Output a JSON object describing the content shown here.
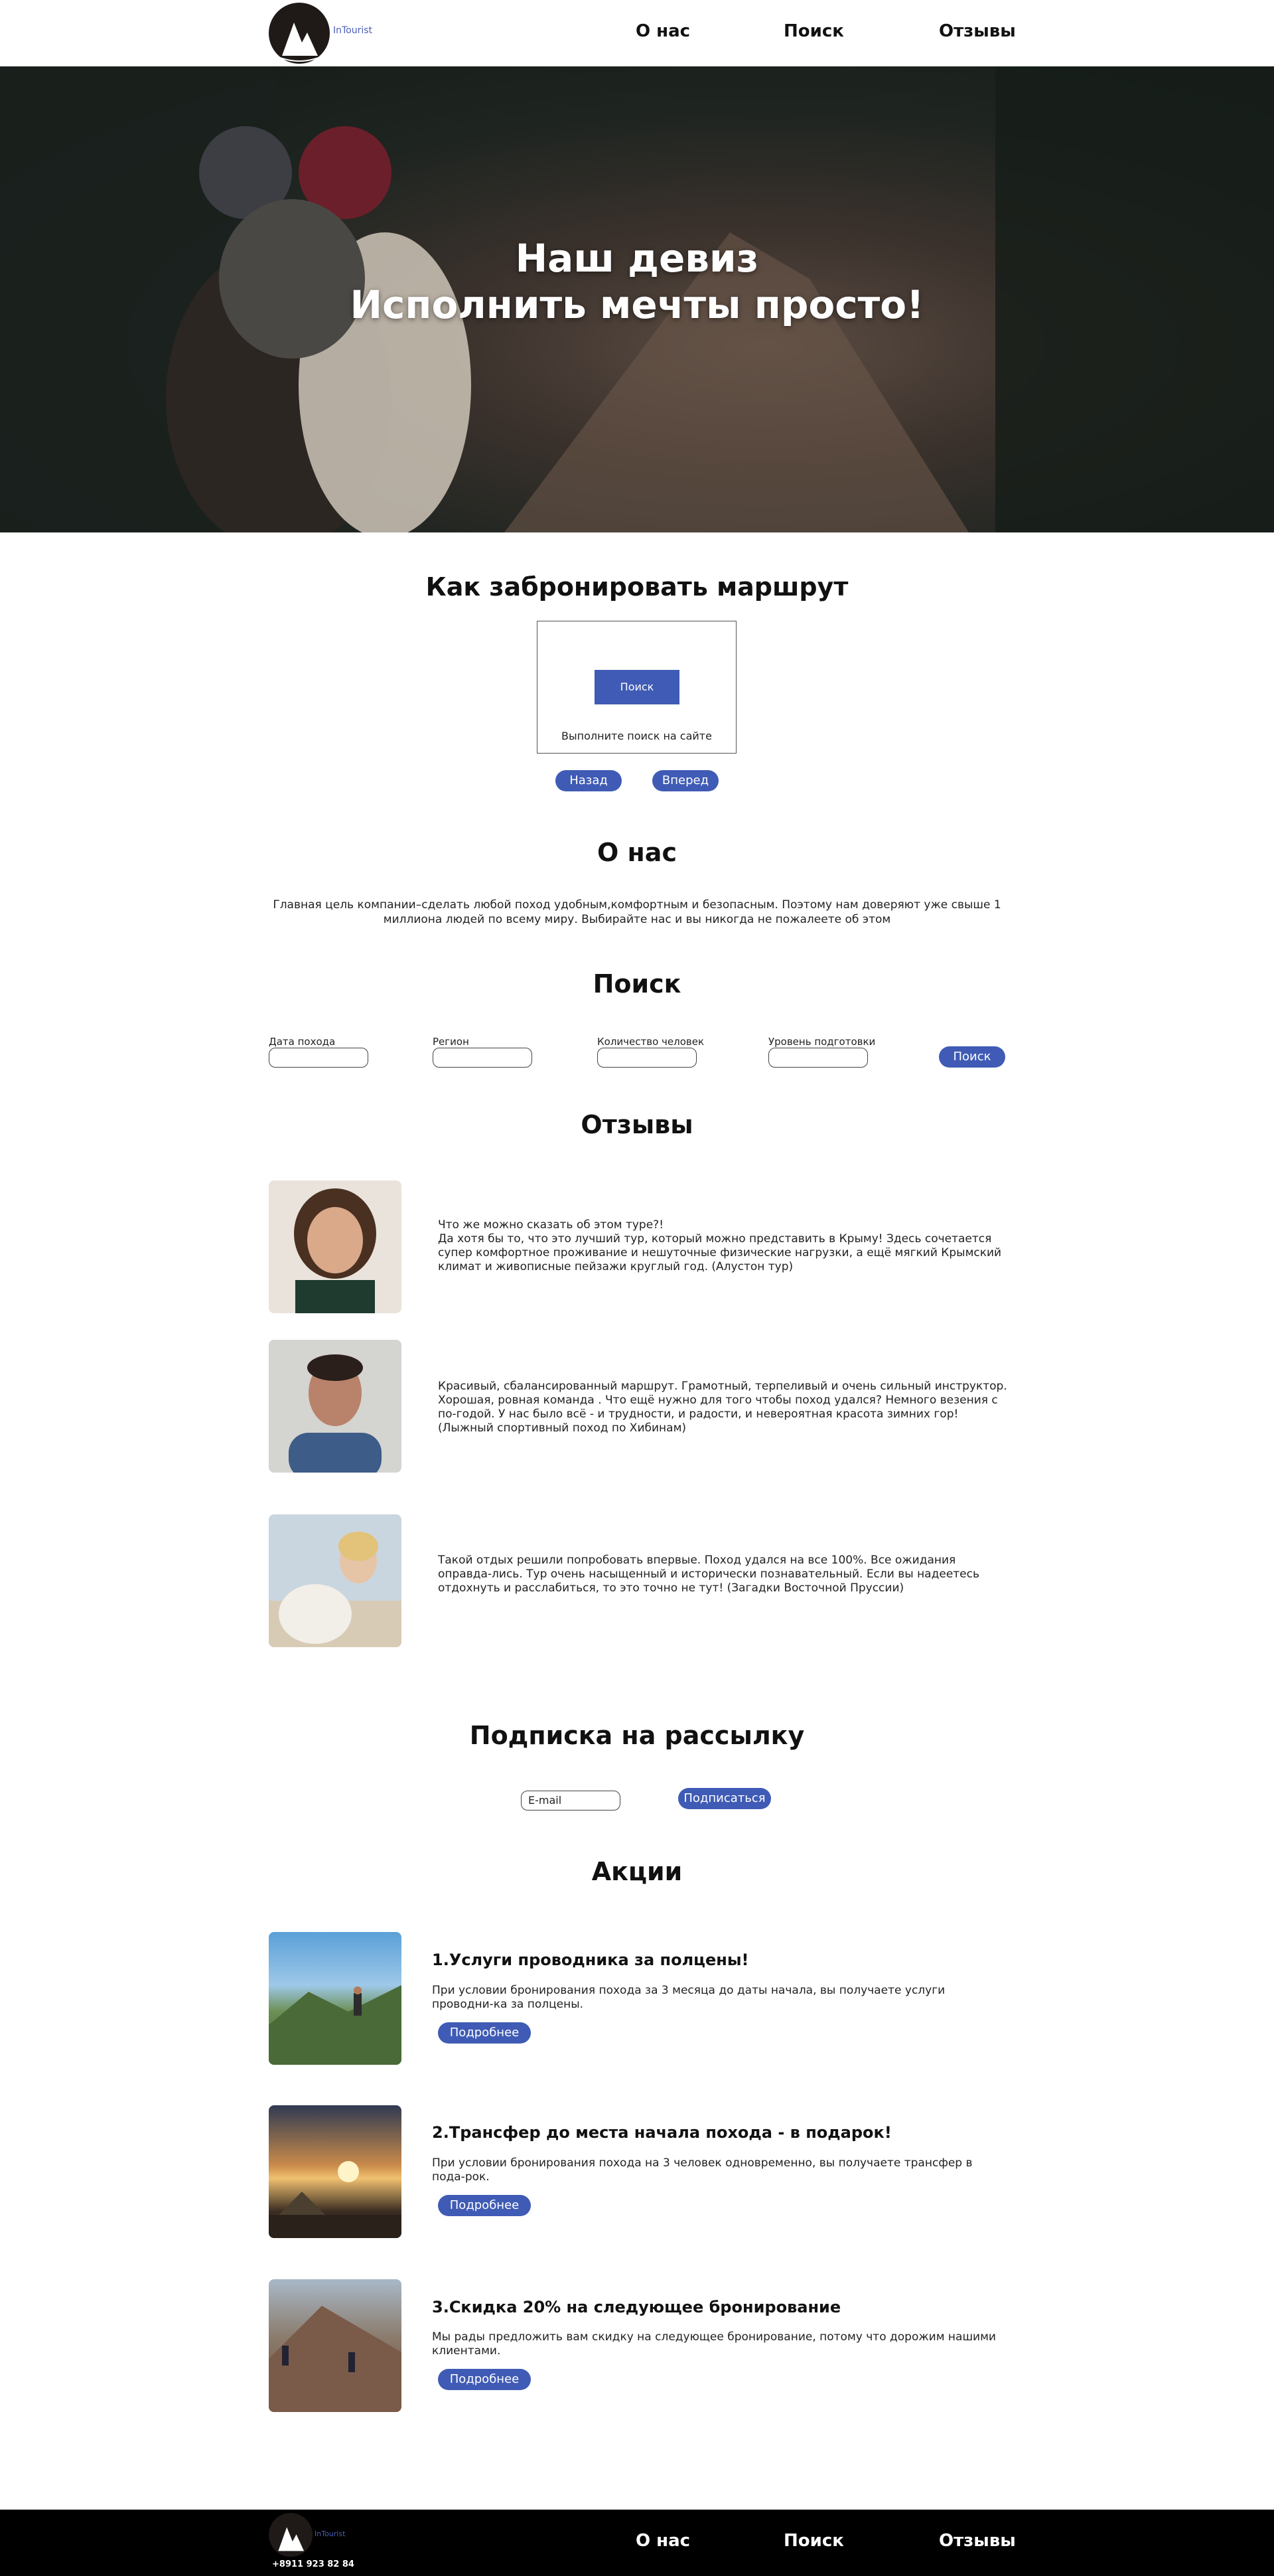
{
  "header": {
    "logo_text": "InTourist",
    "nav": [
      {
        "label": "О нас"
      },
      {
        "label": "Поиск"
      },
      {
        "label": "Отзывы"
      }
    ]
  },
  "hero": {
    "line1": "Наш девиз",
    "line2": "Исполнить мечты просто!"
  },
  "booking": {
    "title": "Как забронировать маршрут",
    "step_button": "Поиск",
    "step_caption": "Выполните поиск на сайте",
    "back_label": "Назад",
    "forward_label": "Вперед"
  },
  "about": {
    "title": "О нас",
    "text": "Главная цель компании–сделать любой поход удобным,комфортным и безопасным. Поэтому нам доверяют уже свыше 1 миллиона людей по всему миру. Выбирайте нас и вы никогда не пожалеете об этом"
  },
  "search": {
    "title": "Поиск",
    "fields": [
      {
        "label": "Дата похода"
      },
      {
        "label": "Регион"
      },
      {
        "label": "Количество человек"
      },
      {
        "label": "Уровень подготовки"
      }
    ],
    "button": "Поиск"
  },
  "reviews": {
    "title": "Отзывы",
    "items": [
      {
        "text": "Что же можно сказать об этом туре?!\nДа хотя бы то, что это лучший тур, который можно представить в Крыму! Здесь сочетается супер комфортное проживание и нешуточные физические нагрузки, а ещё мягкий Крымский климат и живописные пейзажи круглый год. (Алустон тур)"
      },
      {
        "text": "Красивый, сбалансированный маршрут. Грамотный, терпеливый и очень сильный инструктор. Хорошая, ровная команда . Что ещё нужно для того чтобы поход удался? Немного везения с по-годой. У нас было всё - и трудности, и радости, и невероятная красота зимних гор! (Лыжный спортивный поход по Хибинам)"
      },
      {
        "text": "Такой отдых решили попробовать впервые. Поход удался на все 100%. Все ожидания оправда-лись. Тур очень насыщенный и исторически познавательный. Если вы надеетесь отдохнуть и расслабиться, то это точно не тут! (Загадки Восточной Пруссии)"
      }
    ]
  },
  "newsletter": {
    "title": "Подписка на рассылку",
    "email_placeholder": "E-mail",
    "subscribe": "Подписаться"
  },
  "promos": {
    "title": "Акции",
    "items": [
      {
        "title": "1.Услуги проводника за полцены!",
        "text": "При условии бронирования похода за 3 месяца до даты начала, вы получаете услуги проводни-ка за полцены.",
        "button": "Подробнее"
      },
      {
        "title": "2.Трансфер до места начала похода - в подарок!",
        "text": "При условии бронирования похода на 3 человек одновременно, вы получаете трансфер в пода-рок.",
        "button": "Подробнее"
      },
      {
        "title": "3.Скидка 20% на следующее бронирование",
        "text": "Мы рады предложить вам скидку на следующее бронирование, потому что дорожим нашими клиентами.",
        "button": "Подробнее"
      }
    ]
  },
  "footer": {
    "logo_text": "InTourist",
    "phone": "+8911 923 82 84",
    "nav": [
      {
        "label": "О нас"
      },
      {
        "label": "Поиск"
      },
      {
        "label": "Отзывы"
      }
    ]
  },
  "colors": {
    "accent": "#3f5bb5",
    "footer_bg": "#000000"
  }
}
